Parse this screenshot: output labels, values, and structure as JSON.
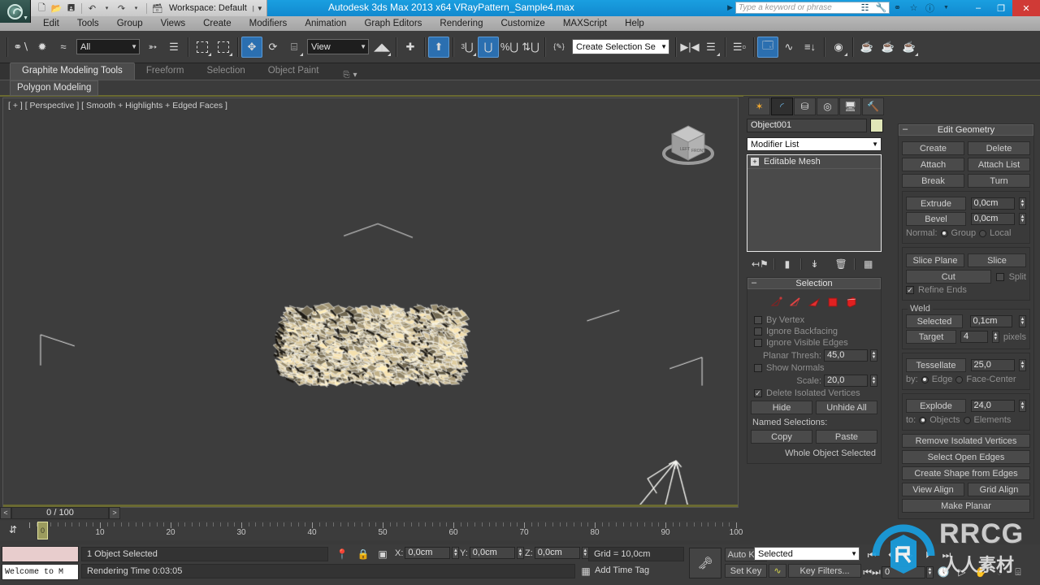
{
  "app": {
    "title": "Autodesk 3ds Max  2013 x64          VRayPattern_Sample4.max",
    "workspace_label": "Workspace: Default",
    "search_placeholder": "Type a keyword or phrase"
  },
  "window_buttons": {
    "minimize": "–",
    "maximize": "❐",
    "close": "✕"
  },
  "title_icons": [
    {
      "name": "steering-wheel-icon",
      "glyph": "⌘"
    },
    {
      "name": "wrench-icon",
      "glyph": "⚒"
    },
    {
      "name": "autodesk-360-icon",
      "glyph": "◠"
    },
    {
      "name": "favorites-star-icon",
      "glyph": "☆"
    },
    {
      "name": "help-icon",
      "glyph": "?"
    }
  ],
  "menu": {
    "items": [
      "Edit",
      "Tools",
      "Group",
      "Views",
      "Create",
      "Modifiers",
      "Animation",
      "Graph Editors",
      "Rendering",
      "Customize",
      "MAXScript",
      "Help"
    ]
  },
  "quick_access": {
    "items": [
      {
        "name": "new-file-icon",
        "glyph": "὜B"
      },
      {
        "name": "open-file-icon",
        "glyph": "὜1"
      },
      {
        "name": "save-file-icon",
        "glyph": "὚B"
      },
      {
        "name": "undo-icon",
        "glyph": "↶"
      },
      {
        "name": "undo-dropdown-icon",
        "glyph": "▾"
      },
      {
        "name": "redo-icon",
        "glyph": "↷"
      },
      {
        "name": "redo-dropdown-icon",
        "glyph": "▾"
      },
      {
        "name": "project-folder-icon",
        "glyph": "὜2"
      }
    ]
  },
  "toolbar": {
    "selection_filter_value": "All",
    "reference_coord_value": "View",
    "selection_set_value": "Create Selection Se",
    "buttons": [
      {
        "name": "select-and-link-icon",
        "glyph": "⚭"
      },
      {
        "name": "unlink-selection-icon",
        "glyph": "⚮"
      },
      {
        "name": "bind-to-space-warp-icon",
        "glyph": "≈"
      },
      {
        "name": "select-object-icon",
        "glyph": "➤"
      },
      {
        "name": "select-by-name-icon",
        "glyph": "☰"
      },
      {
        "name": "select-region-rectangle-icon",
        "glyph": "□"
      },
      {
        "name": "window-crossing-icon",
        "glyph": "▣"
      },
      {
        "name": "select-and-move-icon",
        "glyph": "✥"
      },
      {
        "name": "select-and-rotate-icon",
        "glyph": "↻"
      },
      {
        "name": "select-and-scale-icon",
        "glyph": "⤡"
      },
      {
        "name": "use-center-flyout-icon",
        "glyph": "◆"
      },
      {
        "name": "select-and-manipulate-icon",
        "glyph": "✛"
      },
      {
        "name": "keyboard-shortcut-override-icon",
        "glyph": "⬆"
      },
      {
        "name": "snaps-toggle-icon",
        "glyph": "3Ⓜ"
      },
      {
        "name": "angle-snap-toggle-icon",
        "glyph": "◠"
      },
      {
        "name": "percent-snap-toggle-icon",
        "glyph": "%"
      },
      {
        "name": "spinner-snap-toggle-icon",
        "glyph": "↕"
      },
      {
        "name": "named-selection-sets-icon",
        "glyph": "ABC"
      },
      {
        "name": "mirror-icon",
        "glyph": "▶◀"
      },
      {
        "name": "align-icon",
        "glyph": "≡"
      },
      {
        "name": "layer-manager-icon",
        "glyph": "≣"
      },
      {
        "name": "toggle-scene-explorer-icon",
        "glyph": "Ὕ4"
      },
      {
        "name": "curve-editor-icon",
        "glyph": "∿"
      },
      {
        "name": "schematic-view-icon",
        "glyph": "☰"
      },
      {
        "name": "material-editor-icon",
        "glyph": "◎"
      },
      {
        "name": "render-setup-icon",
        "glyph": "ᾭ6"
      },
      {
        "name": "rendered-frame-window-icon",
        "glyph": "ᾭ6"
      },
      {
        "name": "render-production-icon",
        "glyph": "ᾭ6"
      }
    ]
  },
  "ribbon": {
    "tabs": [
      {
        "label": "Graphite Modeling Tools",
        "active": true
      },
      {
        "label": "Freeform",
        "active": false
      },
      {
        "label": "Selection",
        "active": false
      },
      {
        "label": "Object Paint",
        "active": false
      }
    ],
    "subtab": "Polygon Modeling"
  },
  "viewport": {
    "label": "[ + ] [ Perspective ] [ Smooth + Highlights + Edged Faces ]",
    "background": "#3d3d3d",
    "object_color": "#d9c79b"
  },
  "command_panel": {
    "tabs": [
      {
        "name": "create-tab",
        "glyph": "☀",
        "active": false
      },
      {
        "name": "modify-tab",
        "glyph": "◜",
        "active": true
      },
      {
        "name": "hierarchy-tab",
        "glyph": "⛓",
        "active": false
      },
      {
        "name": "motion-tab",
        "glyph": "◎",
        "active": false
      },
      {
        "name": "display-tab",
        "glyph": "Ὓ5",
        "active": false
      },
      {
        "name": "utilities-tab",
        "glyph": "ὒ8",
        "active": false
      }
    ],
    "object_name": "Object001",
    "modifier_list_label": "Modifier List",
    "stack": [
      {
        "label": "Editable Mesh",
        "expand": "+"
      }
    ],
    "stack_buttons": [
      {
        "name": "pin-stack-icon",
        "glyph": "⚐"
      },
      {
        "name": "show-end-result-icon",
        "glyph": "▮"
      },
      {
        "name": "make-unique-icon",
        "glyph": "⑂"
      },
      {
        "name": "remove-modifier-icon",
        "glyph": "Ὕ1"
      },
      {
        "name": "configure-modifier-sets-icon",
        "glyph": "▦"
      }
    ]
  },
  "selection_rollout": {
    "title": "Selection",
    "sub_object_icons": [
      {
        "name": "vertex-subobject-icon"
      },
      {
        "name": "edge-subobject-icon"
      },
      {
        "name": "face-subobject-icon"
      },
      {
        "name": "polygon-subobject-icon"
      },
      {
        "name": "element-subobject-icon"
      }
    ],
    "by_vertex": {
      "label": "By Vertex",
      "checked": false
    },
    "ignore_backfacing": {
      "label": "Ignore Backfacing",
      "checked": false
    },
    "ignore_visible_edges": {
      "label": "Ignore Visible Edges",
      "checked": false
    },
    "planar_thresh": {
      "label": "Planar Thresh:",
      "value": "45,0"
    },
    "show_normals": {
      "label": "Show Normals",
      "checked": false
    },
    "scale": {
      "label": "Scale:",
      "value": "20,0"
    },
    "delete_isolated_vertices": {
      "label": "Delete Isolated Vertices",
      "checked": true
    },
    "hide_label": "Hide",
    "unhide_all_label": "Unhide All",
    "named_selections_label": "Named Selections:",
    "copy_label": "Copy",
    "paste_label": "Paste",
    "status": "Whole Object Selected"
  },
  "edit_geometry_rollout": {
    "title": "Edit Geometry",
    "create_label": "Create",
    "delete_label": "Delete",
    "attach_label": "Attach",
    "attach_list_label": "Attach List",
    "break_label": "Break",
    "turn_label": "Turn",
    "extrude": {
      "label": "Extrude",
      "value": "0,0cm"
    },
    "bevel": {
      "label": "Bevel",
      "value": "0,0cm"
    },
    "normal_label": "Normal:",
    "normal_group": {
      "label": "Group",
      "selected": true
    },
    "normal_local": {
      "label": "Local",
      "selected": false
    },
    "slice_plane_label": "Slice Plane",
    "slice_label": "Slice",
    "cut_label": "Cut",
    "split": {
      "label": "Split",
      "checked": false
    },
    "refine_ends": {
      "label": "Refine Ends",
      "checked": true
    },
    "weld_group_label": "Weld",
    "weld_selected": {
      "label": "Selected",
      "value": "0,1cm"
    },
    "weld_target": {
      "label": "Target",
      "value": "4",
      "unit": "pixels"
    },
    "tessellate": {
      "label": "Tessellate",
      "value": "25,0"
    },
    "by_label": "by:",
    "by_edge": {
      "label": "Edge",
      "selected": true
    },
    "by_face_center": {
      "label": "Face-Center",
      "selected": false
    },
    "explode": {
      "label": "Explode",
      "value": "24,0"
    },
    "to_label": "to:",
    "to_objects": {
      "label": "Objects",
      "selected": true
    },
    "to_elements": {
      "label": "Elements",
      "selected": false
    },
    "remove_isolated_vertices_label": "Remove Isolated Vertices",
    "select_open_edges_label": "Select Open Edges",
    "create_shape_from_edges_label": "Create Shape from Edges",
    "view_align_label": "View Align",
    "grid_align_label": "Grid Align",
    "make_planar_label": "Make Planar"
  },
  "timeline": {
    "prev_frame": "<",
    "next_frame": ">",
    "current_frame_label": "0 / 100",
    "handle_label": "0",
    "ticks": [
      {
        "value": "10",
        "pos": 10
      },
      {
        "value": "20",
        "pos": 20
      },
      {
        "value": "30",
        "pos": 30
      },
      {
        "value": "40",
        "pos": 40
      },
      {
        "value": "50",
        "pos": 50
      },
      {
        "value": "60",
        "pos": 60
      },
      {
        "value": "70",
        "pos": 70
      },
      {
        "value": "80",
        "pos": 80
      },
      {
        "value": "90",
        "pos": 90
      },
      {
        "value": "100",
        "pos": 100
      }
    ]
  },
  "status_bar": {
    "maxscript_prompt": "Welcome to M",
    "selection_status": "1 Object Selected",
    "render_time": "Rendering Time  0:03:05",
    "x": {
      "label": "X:",
      "value": "0,0cm"
    },
    "y": {
      "label": "Y:",
      "value": "0,0cm"
    },
    "z": {
      "label": "Z:",
      "value": "0,0cm"
    },
    "grid": "Grid = 10,0cm",
    "add_time_tag": "Add Time Tag",
    "auto_key_label": "Auto Key",
    "set_key_label": "Set Key",
    "key_filters_label": "Key Filters...",
    "key_mode_value": "Selected",
    "key_frame_value": "0",
    "icons": [
      {
        "name": "pin-stack-status-icon",
        "glyph": "ὌD"
      },
      {
        "name": "selection-lock-icon",
        "glyph": "ὑ2"
      },
      {
        "name": "absolute-relative-transform-icon",
        "glyph": "✣"
      },
      {
        "name": "adaptive-degradation-icon",
        "glyph": "▣"
      }
    ],
    "nav_icons": [
      {
        "name": "go-to-start-icon",
        "glyph": "⏮"
      },
      {
        "name": "previous-frame-icon",
        "glyph": "⏴"
      },
      {
        "name": "play-animation-icon",
        "glyph": "▶"
      },
      {
        "name": "next-frame-icon",
        "glyph": "⏵"
      },
      {
        "name": "go-to-end-icon",
        "glyph": "⏭"
      },
      {
        "name": "time-configuration-icon",
        "glyph": "ὕ1"
      },
      {
        "name": "zoom-viewport-icon",
        "glyph": "▷"
      },
      {
        "name": "pan-view-icon",
        "glyph": "✋"
      },
      {
        "name": "orbit-icon",
        "glyph": "◔"
      },
      {
        "name": "maximize-viewport-toggle-icon",
        "glyph": "⤡"
      }
    ]
  },
  "watermark": {
    "text": "RRCG",
    "cn_text": "人人素材"
  }
}
